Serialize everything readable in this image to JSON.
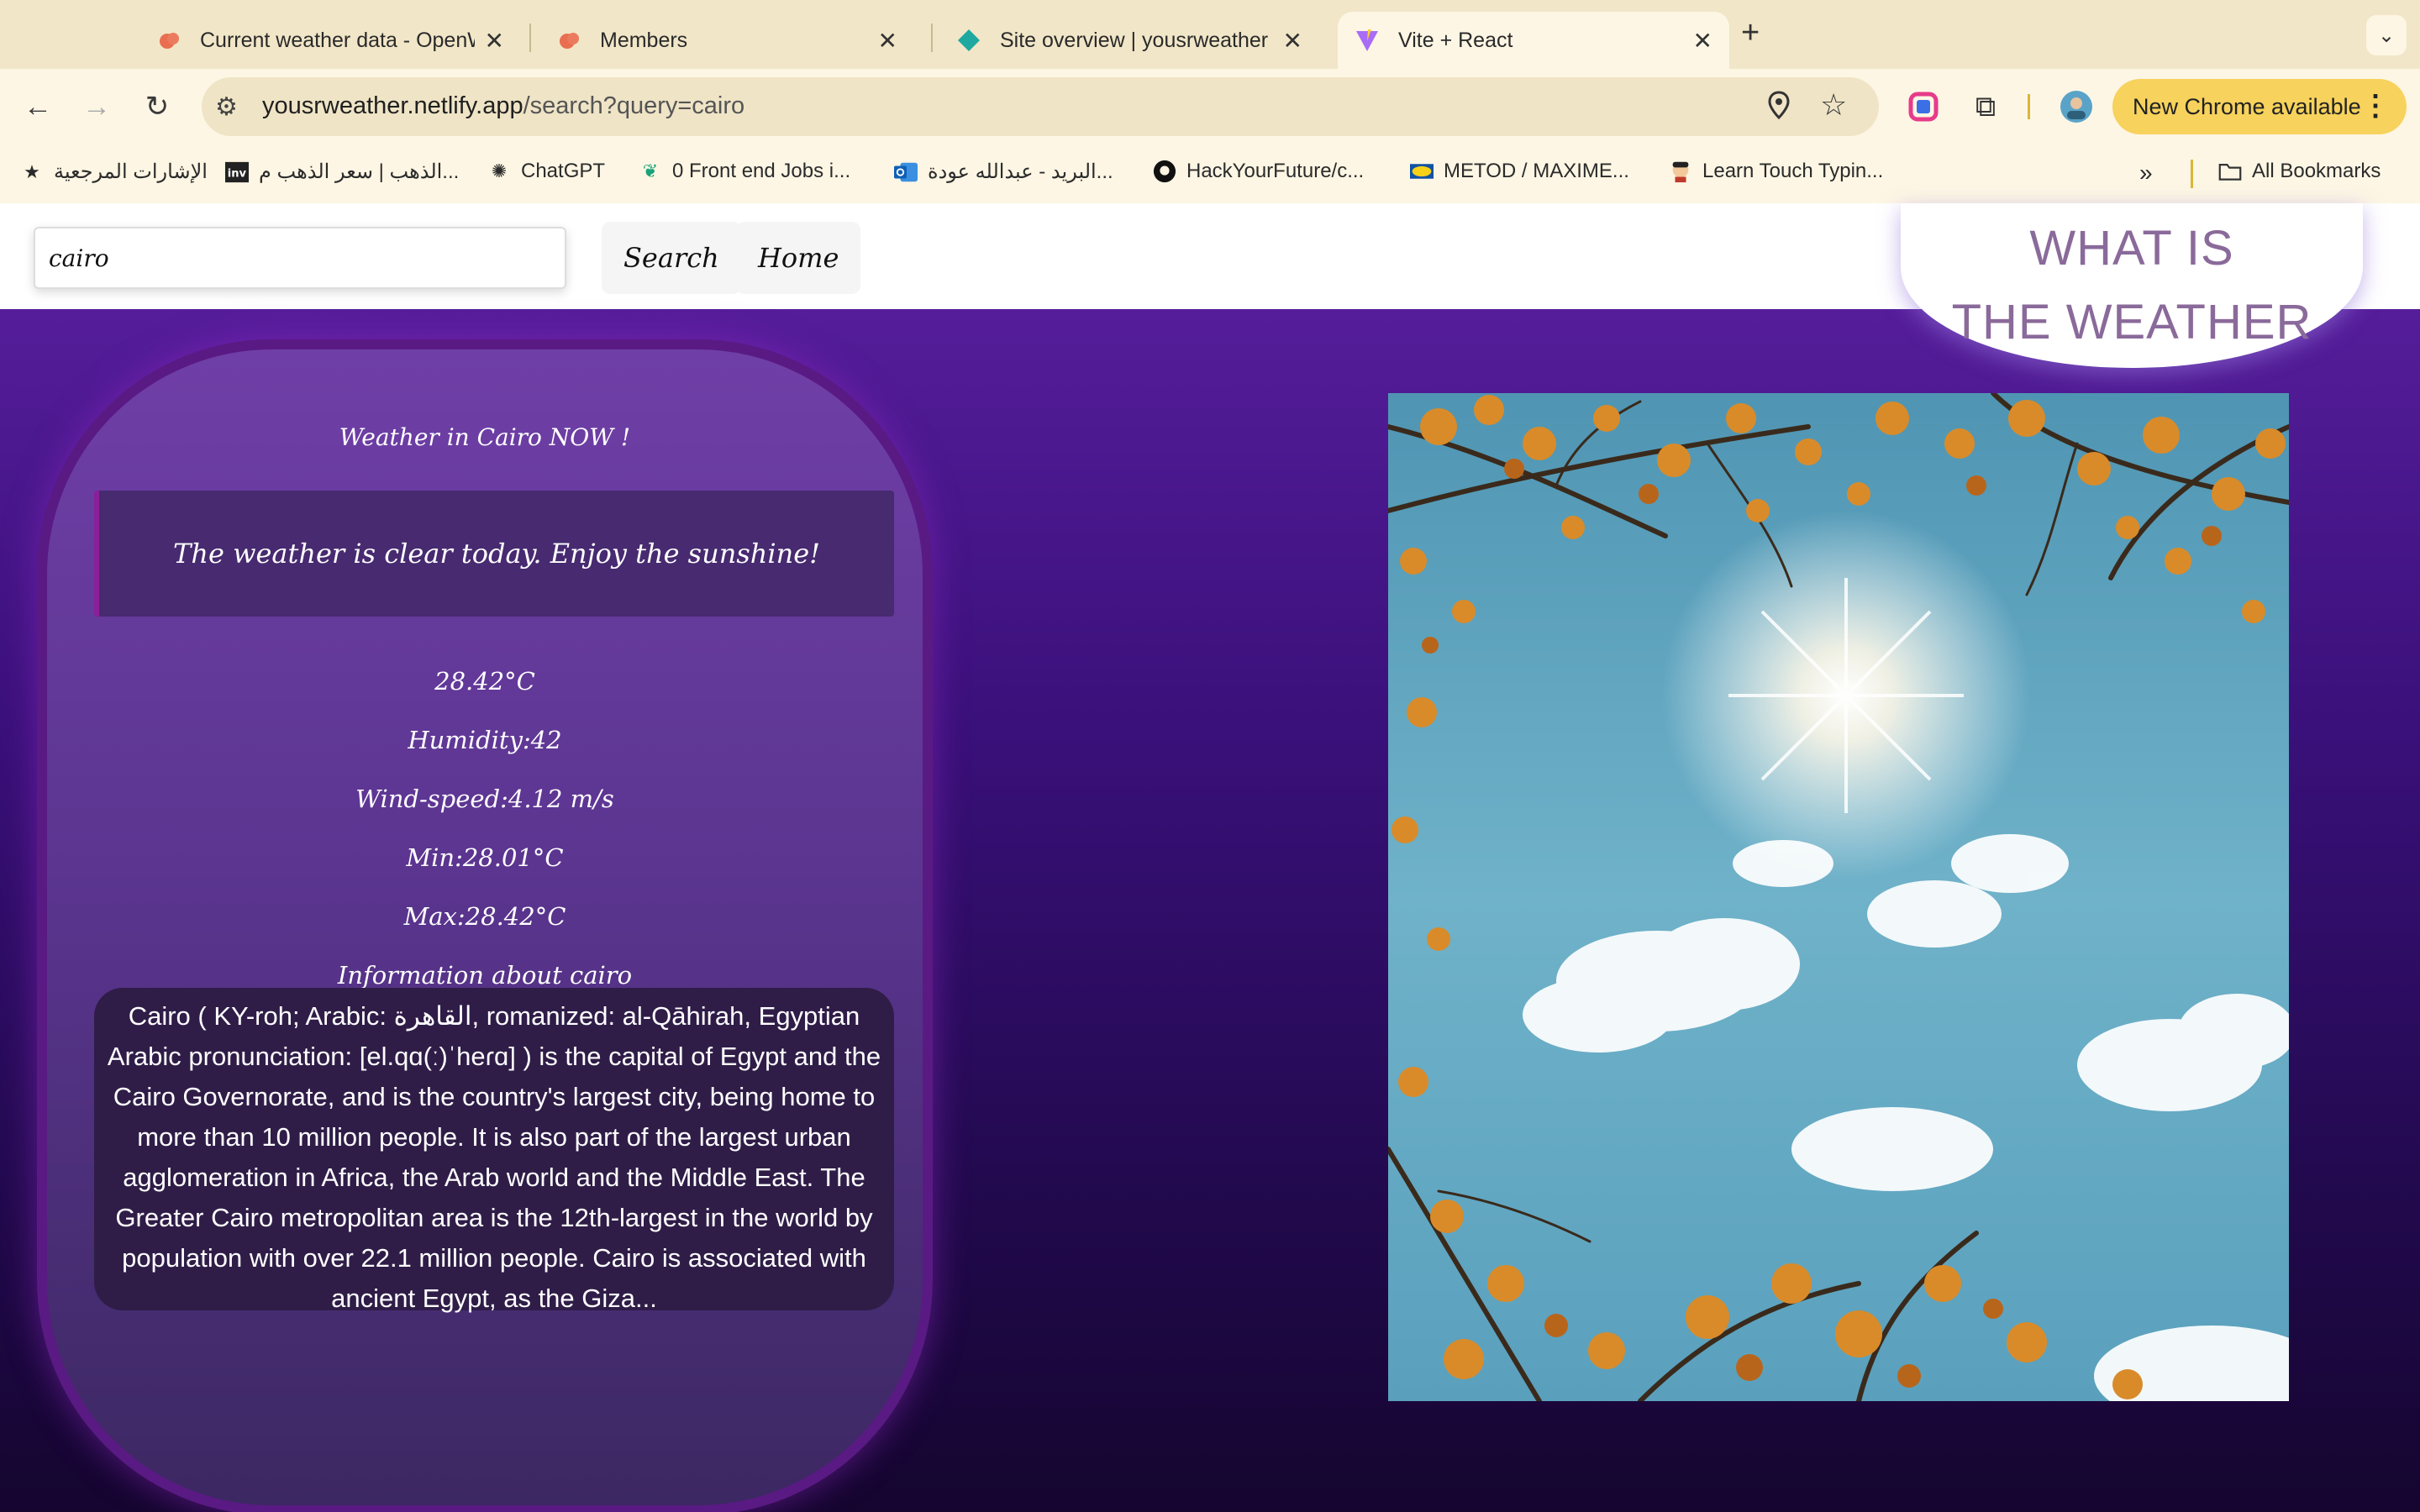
{
  "browser": {
    "tabs": [
      {
        "title": "Current weather data - OpenWeatherMap",
        "icon": "openweather-icon"
      },
      {
        "title": "Members",
        "icon": "openweather-icon"
      },
      {
        "title": "Site overview | yousrweather",
        "icon": "netlify-icon"
      },
      {
        "title": "Vite + React",
        "icon": "vite-icon",
        "active": true
      }
    ],
    "url_host": "yousrweather.netlify.app",
    "url_path": "/search?query=cairo",
    "new_chrome_label": "New Chrome available",
    "bookmarks": [
      {
        "label": "الإشارات المرجعية",
        "icon": "star-icon"
      },
      {
        "label": "الذهب | سعر الذهب م...",
        "icon": "inv-icon"
      },
      {
        "label": "ChatGPT",
        "icon": "chatgpt-icon"
      },
      {
        "label": "0 Front end Jobs i...",
        "icon": "jobs-icon"
      },
      {
        "label": "البريد - عبدالله عودة...",
        "icon": "outlook-icon"
      },
      {
        "label": "HackYourFuture/c...",
        "icon": "github-icon"
      },
      {
        "label": "METOD / MAXIME...",
        "icon": "ikea-icon"
      },
      {
        "label": "Learn Touch Typin...",
        "icon": "typing-icon"
      }
    ],
    "all_bookmarks_label": "All Bookmarks"
  },
  "header": {
    "search_value": "cairo",
    "search_button": "Search",
    "home_button": "Home",
    "title_line1": "WHAT IS",
    "title_line2": "THE WEATHER"
  },
  "weather": {
    "heading": "Weather in Cairo NOW !",
    "description": "The weather is clear today. Enjoy the sunshine!",
    "temperature": "28.42°C",
    "humidity": "Humidity:42",
    "wind": "Wind-speed:4.12 m/s",
    "min": "Min:28.01°C",
    "max": "Max:28.42°C",
    "info_heading": "Information about cairo",
    "info_text": "Cairo ( KY-roh; Arabic: القاهرة, romanized: al-Qāhirah, Egyptian Arabic pronunciation: [el.qɑ(ː)ˈheɾɑ] ) is the capital of Egypt and the Cairo Governorate, and is the country's largest city, being home to more than 10 million people. It is also part of the largest urban agglomeration in Africa, the Arab world and the Middle East. The Greater Cairo metropolitan area is the 12th-largest in the world by population with over 22.1 million people. Cairo is associated with ancient Egypt, as the Giza..."
  },
  "colors": {
    "accent": "#551d9a",
    "card": "#6f3fa7",
    "title": "#8a6a9a",
    "chrome_banner": "#f7d25c"
  }
}
